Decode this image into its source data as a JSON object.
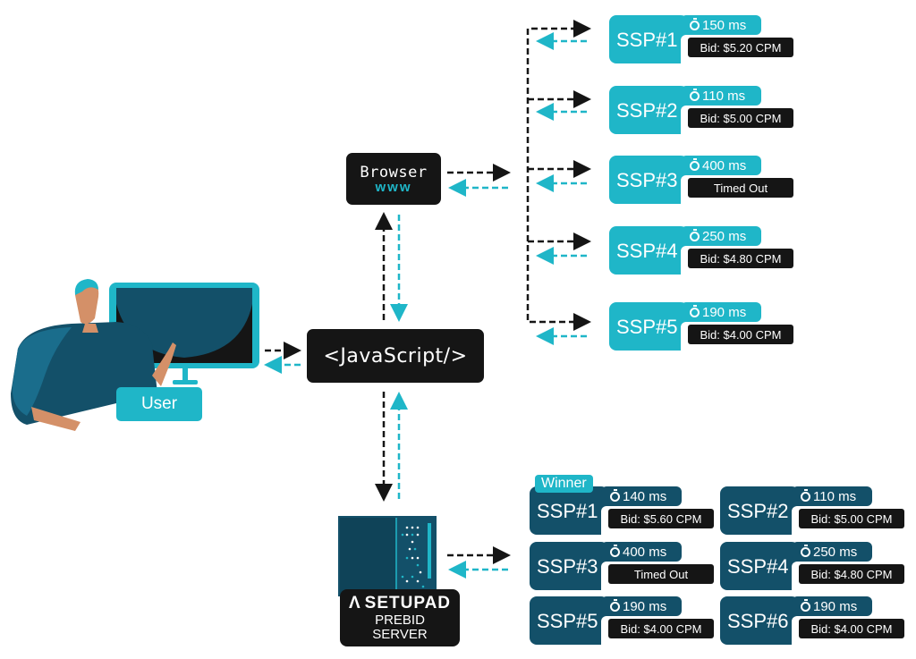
{
  "colors": {
    "teal": "#1fb6c8",
    "navy": "#135069",
    "dark": "#151515",
    "skin": "#d49068"
  },
  "user": {
    "label": "User"
  },
  "browser": {
    "title": "Browser",
    "subtitle": "www"
  },
  "javascript": {
    "label": "<JavaScript/>"
  },
  "prebid_server": {
    "brand": "SETUPAD",
    "line1": "PREBID",
    "line2": "SERVER",
    "logo_icon": "setupad-logo-icon"
  },
  "client_side_ssps": [
    {
      "name": "SSP#1",
      "time": "150 ms",
      "result": "Bid: $5.20 CPM"
    },
    {
      "name": "SSP#2",
      "time": "110 ms",
      "result": "Bid: $5.00 CPM"
    },
    {
      "name": "SSP#3",
      "time": "400 ms",
      "result": "Timed Out"
    },
    {
      "name": "SSP#4",
      "time": "250 ms",
      "result": "Bid: $4.80 CPM"
    },
    {
      "name": "SSP#5",
      "time": "190 ms",
      "result": "Bid: $4.00 CPM"
    }
  ],
  "server_side_ssps": [
    {
      "name": "SSP#1",
      "time": "140 ms",
      "result": "Bid: $5.60 CPM",
      "winner": true
    },
    {
      "name": "SSP#2",
      "time": "110 ms",
      "result": "Bid: $5.00 CPM"
    },
    {
      "name": "SSP#3",
      "time": "400 ms",
      "result": "Timed Out"
    },
    {
      "name": "SSP#4",
      "time": "250 ms",
      "result": "Bid: $4.80 CPM"
    },
    {
      "name": "SSP#5",
      "time": "190 ms",
      "result": "Bid: $4.00 CPM"
    },
    {
      "name": "SSP#6",
      "time": "190 ms",
      "result": "Bid: $4.00 CPM"
    }
  ],
  "winner_label": "Winner"
}
